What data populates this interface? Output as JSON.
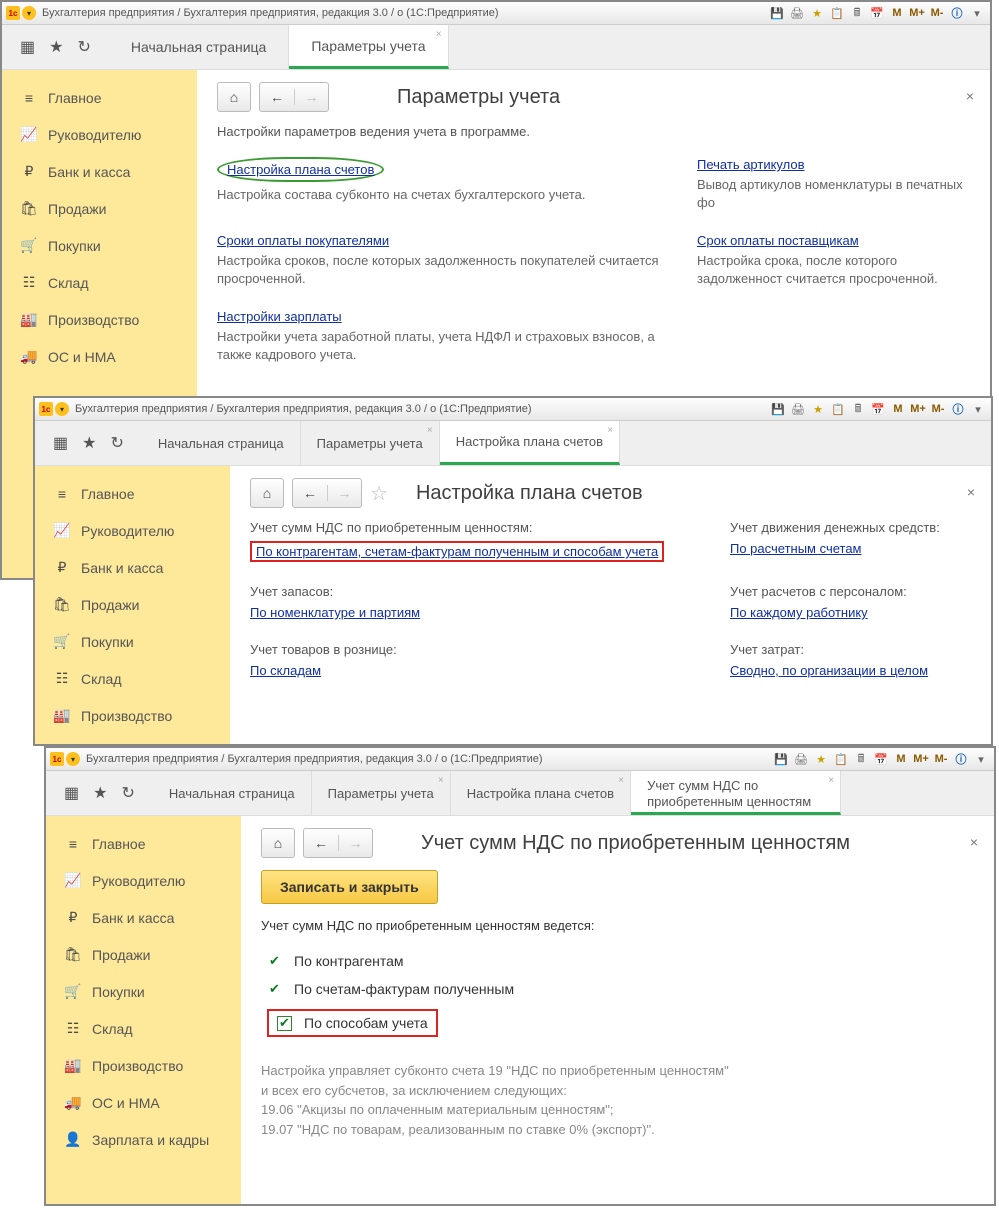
{
  "titlebar": "Бухгалтерия предприятия / Бухгалтерия предприятия, редакция 3.0 / o   (1С:Предприятие)",
  "toolbar_codes": {
    "m": "М",
    "mplus": "М+",
    "mminus": "М-"
  },
  "tabs_w1": {
    "home": "Начальная страница",
    "t1": "Параметры учета"
  },
  "tabs_w2": {
    "home": "Начальная страница",
    "t1": "Параметры учета",
    "t2": "Настройка плана счетов"
  },
  "tabs_w3": {
    "home": "Начальная страница",
    "t1": "Параметры учета",
    "t2": "Настройка плана счетов",
    "t3": "Учет сумм НДС по приобретенным ценностям"
  },
  "sidebar": [
    {
      "icon": "≡",
      "label": "Главное"
    },
    {
      "icon": "📈",
      "label": "Руководителю"
    },
    {
      "icon": "₽",
      "label": "Банк и касса"
    },
    {
      "icon": "🛍",
      "label": "Продажи"
    },
    {
      "icon": "🛒",
      "label": "Покупки"
    },
    {
      "icon": "☷",
      "label": "Склад"
    },
    {
      "icon": "🏭",
      "label": "Производство"
    },
    {
      "icon": "🚚",
      "label": "ОС и НМА"
    },
    {
      "icon": "👤",
      "label": "Зарплата и кадры"
    }
  ],
  "w1": {
    "title": "Параметры учета",
    "intro": "Настройки параметров ведения учета в программе.",
    "cells": [
      {
        "link": "Настройка плана счетов",
        "desc": "Настройка состава субконто на счетах бухгалтерского учета."
      },
      {
        "link": "Печать артикулов",
        "desc": "Вывод артикулов номенклатуры в печатных фо"
      },
      {
        "link": "Сроки оплаты покупателями",
        "desc": "Настройка сроков, после которых задолженность покупателей считается просроченной."
      },
      {
        "link": "Срок оплаты поставщикам",
        "desc": "Настройка срока, после которого задолженност считается просроченной."
      },
      {
        "link": "Настройки зарплаты",
        "desc": "Настройки учета заработной платы, учета НДФЛ и страховых взносов, а также кадрового учета."
      }
    ]
  },
  "w2": {
    "title": "Настройка плана счетов",
    "rows": [
      {
        "l_label": "Учет сумм НДС по приобретенным ценностям:",
        "l_link": "По контрагентам, счетам-фактурам полученным и способам учета",
        "r_label": "Учет движения денежных средств:",
        "r_link": "По расчетным счетам"
      },
      {
        "l_label": "Учет запасов:",
        "l_link": "По номенклатуре и партиям",
        "r_label": "Учет расчетов с персоналом:",
        "r_link": "По каждому работнику"
      },
      {
        "l_label": "Учет товаров в рознице:",
        "l_link": "По складам",
        "r_label": "Учет затрат:",
        "r_link": "Сводно, по организации в целом"
      }
    ]
  },
  "w3": {
    "title": "Учет сумм НДС по приобретенным ценностям",
    "save": "Записать и закрыть",
    "lead": "Учет сумм НДС по приобретенным ценностям ведется:",
    "checks": [
      {
        "t": "По контрагентам",
        "box": false
      },
      {
        "t": "По счетам-фактурам полученным",
        "box": false
      },
      {
        "t": "По способам учета",
        "box": true
      }
    ],
    "hint1": "Настройка управляет субконто счета 19 \"НДС по приобретенным ценностям\"",
    "hint2": "и всех его субсчетов, за исключением следующих:",
    "hint3": "19.06 \"Акцизы по оплаченным материальным ценностям\";",
    "hint4": "19.07 \"НДС по товарам, реализованным по ставке 0% (экспорт)\"."
  }
}
